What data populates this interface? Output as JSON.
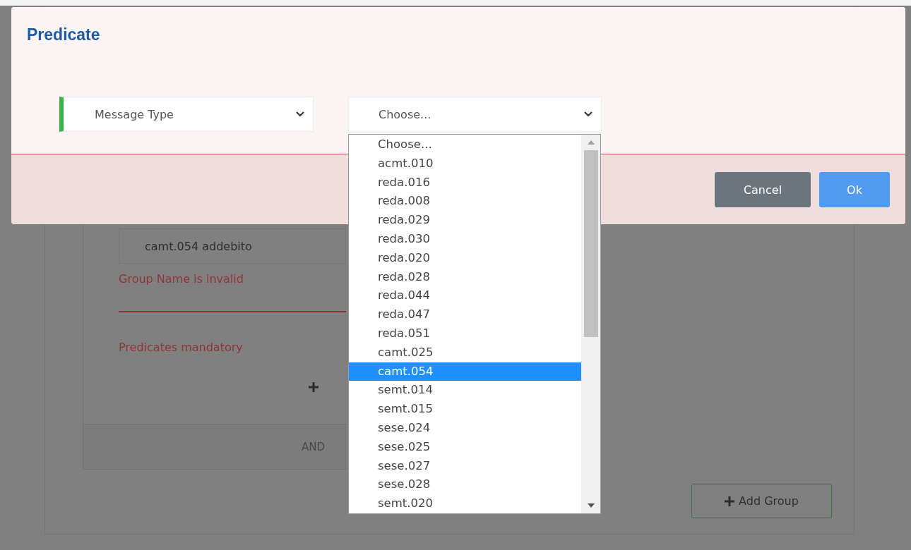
{
  "modal": {
    "title": "Predicate",
    "field_select": {
      "value": "Message Type"
    },
    "value_select": {
      "value": "Choose...",
      "open": true,
      "options": [
        {
          "label": "Choose...",
          "highlighted": false
        },
        {
          "label": "acmt.010",
          "highlighted": false
        },
        {
          "label": "reda.016",
          "highlighted": false
        },
        {
          "label": "reda.008",
          "highlighted": false
        },
        {
          "label": "reda.029",
          "highlighted": false
        },
        {
          "label": "reda.030",
          "highlighted": false
        },
        {
          "label": "reda.020",
          "highlighted": false
        },
        {
          "label": "reda.028",
          "highlighted": false
        },
        {
          "label": "reda.044",
          "highlighted": false
        },
        {
          "label": "reda.047",
          "highlighted": false
        },
        {
          "label": "reda.051",
          "highlighted": false
        },
        {
          "label": "camt.025",
          "highlighted": false
        },
        {
          "label": "camt.054",
          "highlighted": true
        },
        {
          "label": "semt.014",
          "highlighted": false
        },
        {
          "label": "semt.015",
          "highlighted": false
        },
        {
          "label": "sese.024",
          "highlighted": false
        },
        {
          "label": "sese.025",
          "highlighted": false
        },
        {
          "label": "sese.027",
          "highlighted": false
        },
        {
          "label": "sese.028",
          "highlighted": false
        },
        {
          "label": "semt.020",
          "highlighted": false
        }
      ]
    },
    "buttons": [
      {
        "label": "Cancel",
        "kind": "secondary"
      },
      {
        "label": "Ok",
        "kind": "primary"
      }
    ]
  },
  "background": {
    "group_name": {
      "value": "camt.054 addebito"
    },
    "errors": [
      "Group Name is invalid",
      "Predicates mandatory"
    ],
    "operator": "AND",
    "add_group": {
      "label": "Add Group"
    }
  }
}
